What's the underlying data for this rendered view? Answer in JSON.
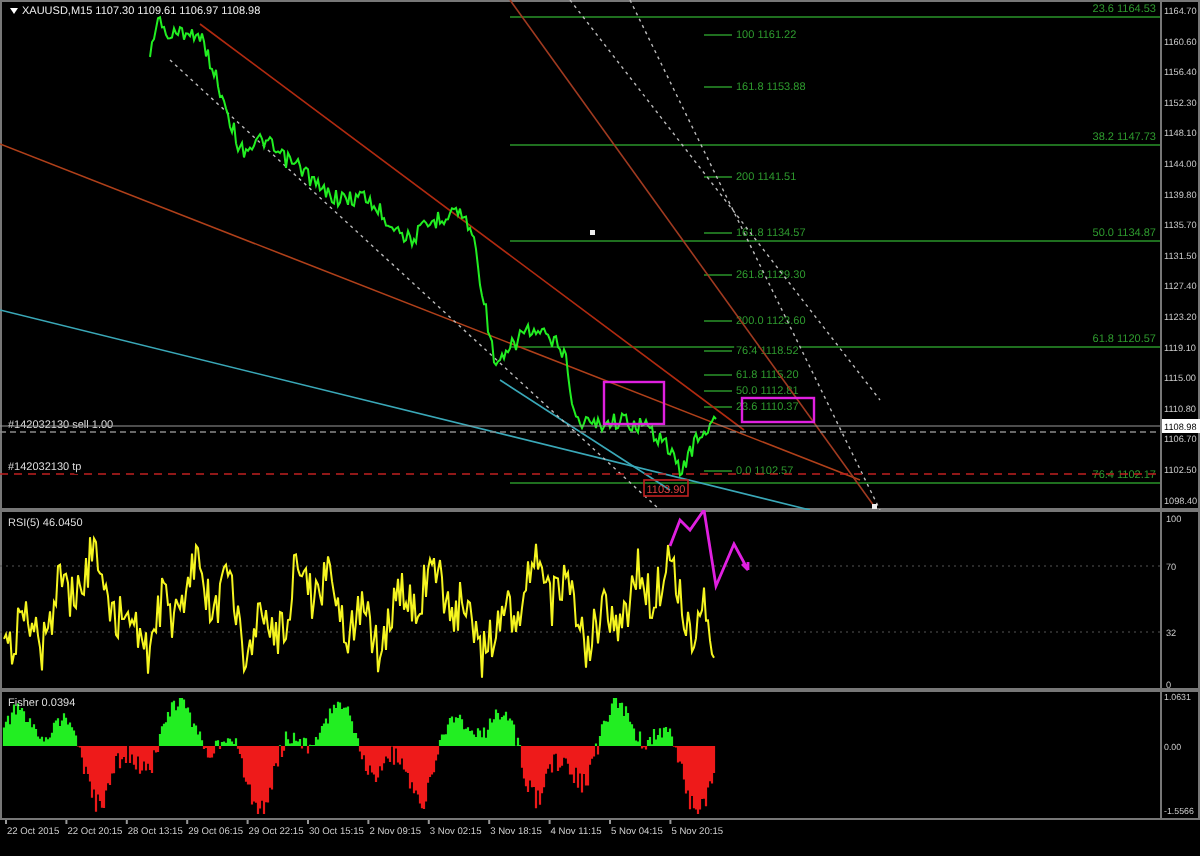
{
  "symbol_header": "XAUUSD,M15  1107.30 1109.61 1106.97 1108.98",
  "price_axis": [
    "1164.70",
    "1160.60",
    "1156.40",
    "1152.30",
    "1148.10",
    "1144.00",
    "1139.80",
    "1135.70",
    "1131.50",
    "1127.40",
    "1123.20",
    "1119.10",
    "1115.00",
    "1110.80",
    "1106.70",
    "1102.50",
    "1098.40"
  ],
  "current_price": "1108.98",
  "fib_levels": [
    {
      "text": "23.6 1164.53",
      "kind": "full"
    },
    {
      "text": "100 1161.22",
      "kind": "short"
    },
    {
      "text": "161.8 1153.88",
      "kind": "short"
    },
    {
      "text": "38.2 1147.73",
      "kind": "full"
    },
    {
      "text": "200 1141.51",
      "kind": "short"
    },
    {
      "text": "161.8 1134.57",
      "kind": "short"
    },
    {
      "text": "50.0 1134.87",
      "kind": "full"
    },
    {
      "text": "261.8 1129.30",
      "kind": "short"
    },
    {
      "text": "200.0 1123.60",
      "kind": "short"
    },
    {
      "text": "61.8 1120.57",
      "kind": "full"
    },
    {
      "text": "76.4 1118.52",
      "kind": "short"
    },
    {
      "text": "61.8 1115.20",
      "kind": "short"
    },
    {
      "text": "50.0 1112.81",
      "kind": "short"
    },
    {
      "text": "23.6 1110.37",
      "kind": "short"
    },
    {
      "text": "0.0 1102.57",
      "kind": "short"
    },
    {
      "text": "76.4 1102.17",
      "kind": "full"
    }
  ],
  "orders": [
    {
      "text": "#142032130 sell 1.00",
      "kind": "entry"
    },
    {
      "text": "#142032130 tp",
      "kind": "tp"
    }
  ],
  "price_tag": "1103.90",
  "rsi": {
    "label": "RSI(5) 46.0450",
    "axis": [
      "100",
      "70",
      "32",
      "0"
    ]
  },
  "fisher": {
    "label": "Fisher 0.0394",
    "axis": [
      "1.0631",
      "0.00",
      "-1.5566"
    ]
  },
  "time_axis": [
    "22 Oct 2015",
    "22 Oct 20:15",
    "28 Oct 13:15",
    "29 Oct 06:15",
    "29 Oct 22:15",
    "30 Oct 15:15",
    "2 Nov 09:15",
    "3 Nov 02:15",
    "3 Nov 18:15",
    "4 Nov 11:15",
    "5 Nov 04:15",
    "5 Nov 20:15"
  ]
}
